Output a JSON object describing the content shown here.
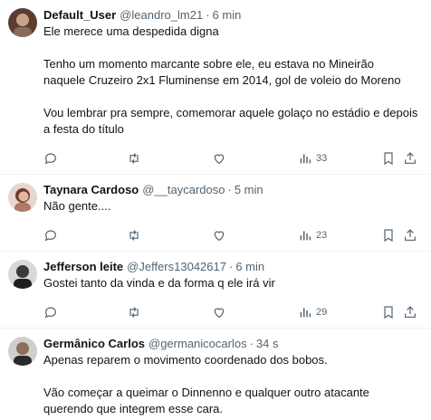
{
  "tweets": [
    {
      "name": "Default_User",
      "handle": "@leandro_lm21",
      "time": "6 min",
      "paragraphs": [
        "Ele merece uma despedida digna",
        "Tenho um momento marcante sobre ele, eu estava no Mineirão naquele Cruzeiro 2x1 Fluminense em 2014, gol de voleio do Moreno",
        "Vou lembrar pra sempre, comemorar aquele golaço no estádio e depois a festa do título"
      ],
      "views": "33",
      "avatar_colors": [
        "#6b4b3a",
        "#c9a48a"
      ]
    },
    {
      "name": "Taynara Cardoso",
      "handle": "@__taycardoso",
      "time": "5 min",
      "paragraphs": [
        "Não gente...."
      ],
      "views": "23",
      "avatar_colors": [
        "#7a4a36",
        "#e0b7a2"
      ]
    },
    {
      "name": "Jefferson leite",
      "handle": "@Jeffers13042617",
      "time": "6 min",
      "paragraphs": [
        "Gostei tanto da vinda e da forma q ele irá vir"
      ],
      "views": "29",
      "avatar_colors": [
        "#1e1e1e",
        "#6c6c6c"
      ]
    },
    {
      "name": "Germânico Carlos",
      "handle": "@germanicocarlos",
      "time": "34 s",
      "paragraphs": [
        "Apenas reparem o movimento coordenado dos bobos.",
        "Vão começar a queimar o Dinnenno e qualquer  outro atacante querendo que integrem esse cara."
      ],
      "views": null,
      "avatar_colors": [
        "#2a2a2a",
        "#8c6e5a"
      ]
    }
  ],
  "dot": "·",
  "colors": {
    "text": "#0f1419",
    "muted": "#536471",
    "divider": "#eff3f4"
  }
}
